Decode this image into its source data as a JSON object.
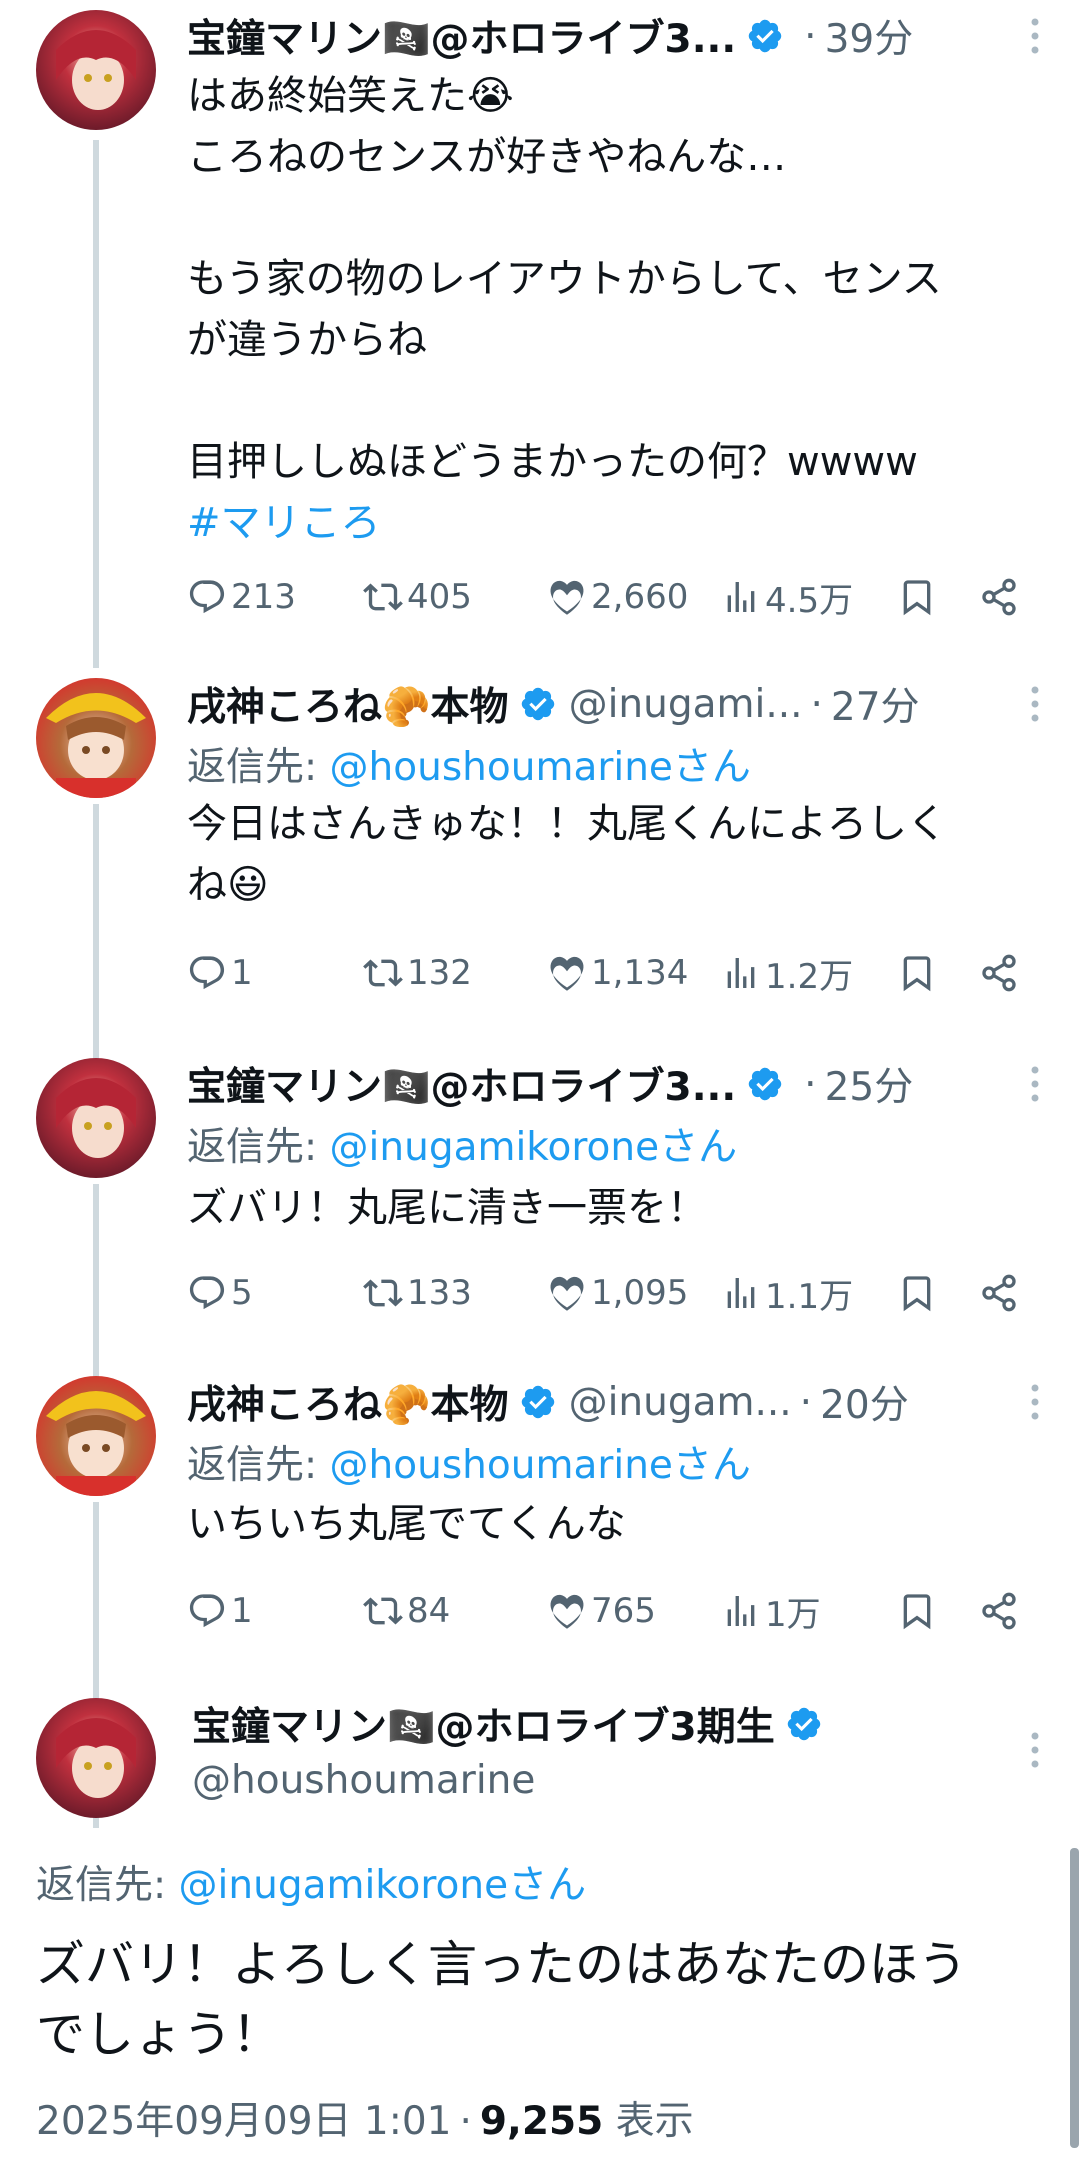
{
  "tweets": [
    {
      "name": "宝鐘マリン🏴‍☠️@ホロライブ3...",
      "handle": "",
      "time": "39分",
      "reply_to_label": "",
      "reply_to_mention": "",
      "text": "はあ終始笑えた😭\nころねのセンスが好きやねんな…\n\nもう家の物のレイアウトからして、センス\nが違うからね\n\n目押ししぬほどうまかったの何？wwww",
      "hashtag": "#マリころ",
      "replies": "213",
      "reposts": "405",
      "likes": "2,660",
      "views": "4.5万"
    },
    {
      "name": "戌神ころね🥐本物",
      "handle": "@inugami...",
      "time": "27分",
      "reply_to_label": "返信先: ",
      "reply_to_mention": "@houshoumarineさん",
      "text": "今日はさんきゅな！！丸尾くんによろしく\nね😃",
      "replies": "1",
      "reposts": "132",
      "likes": "1,134",
      "views": "1.2万"
    },
    {
      "name": "宝鐘マリン🏴‍☠️@ホロライブ3...",
      "handle": "",
      "time": "25分",
      "reply_to_label": "返信先: ",
      "reply_to_mention": "@inugamikoroneさん",
      "text": "ズバリ！丸尾に清き一票を！",
      "replies": "5",
      "reposts": "133",
      "likes": "1,095",
      "views": "1.1万"
    },
    {
      "name": "戌神ころね🥐本物",
      "handle": "@inugam...",
      "time": "20分",
      "reply_to_label": "返信先: ",
      "reply_to_mention": "@houshoumarineさん",
      "text": "いちいち丸尾でてくんな",
      "replies": "1",
      "reposts": "84",
      "likes": "765",
      "views": "1万"
    }
  ],
  "main_tweet": {
    "name": "宝鐘マリン🏴‍☠️@ホロライブ3期生",
    "handle": "@houshoumarine",
    "reply_to_label": "返信先: ",
    "reply_to_mention": "@inugamikoroneさん",
    "text": "ズバリ！よろしく言ったのはあなたのほう\nでしょう！",
    "timestamp": "2025年09月09日 1:01",
    "views_count": "9,255",
    "views_label": "表示"
  },
  "colors": {
    "accent": "#1d9bf0",
    "secondary_text": "#536471",
    "thread_line": "#cfd9de",
    "verified": "#1d9bf0"
  },
  "icons": [
    "reply-icon",
    "repost-icon",
    "like-icon",
    "views-icon",
    "bookmark-icon",
    "share-icon",
    "more-icon",
    "verified-badge-icon"
  ]
}
